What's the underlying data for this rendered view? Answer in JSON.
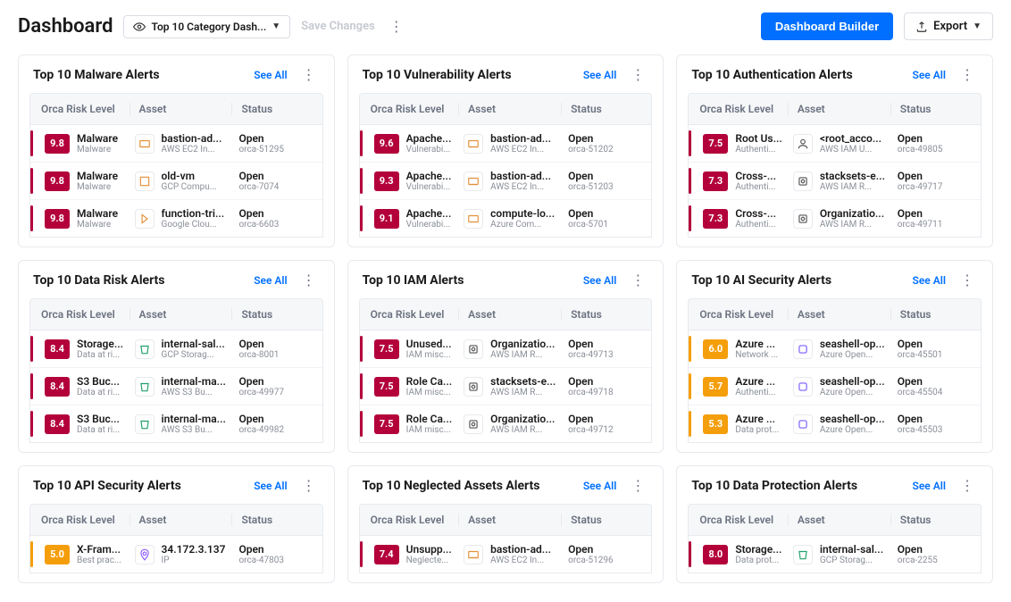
{
  "header": {
    "title": "Dashboard",
    "dashboard_selector": "Top 10 Category Dash...",
    "save_label": "Save Changes",
    "builder_label": "Dashboard Builder",
    "export_label": "Export"
  },
  "labels": {
    "see_all": "See All",
    "columns": {
      "risk": "Orca Risk Level",
      "asset": "Asset",
      "status": "Status"
    }
  },
  "cards": [
    {
      "title": "Top 10 Malware Alerts",
      "rows": [
        {
          "score": "9.8",
          "sev": "crimson",
          "risk_l1": "Malware",
          "risk_l2": "Malware",
          "asset_l1": "bastion-ad...",
          "asset_l2": "AWS EC2 In...",
          "status_l1": "Open",
          "status_l2": "orca-51295",
          "icon": "aws"
        },
        {
          "score": "9.8",
          "sev": "crimson",
          "risk_l1": "Malware",
          "risk_l2": "Malware",
          "asset_l1": "old-vm",
          "asset_l2": "GCP Compu...",
          "status_l1": "Open",
          "status_l2": "orca-7074",
          "icon": "gcp"
        },
        {
          "score": "9.8",
          "sev": "crimson",
          "risk_l1": "Malware",
          "risk_l2": "Malware",
          "asset_l1": "function-tri...",
          "asset_l2": "Google Clou...",
          "status_l1": "Open",
          "status_l2": "orca-6603",
          "icon": "gcp-fn"
        }
      ]
    },
    {
      "title": "Top 10 Vulnerability Alerts",
      "rows": [
        {
          "score": "9.6",
          "sev": "crimson",
          "risk_l1": "Apache...",
          "risk_l2": "Vulnerabi...",
          "asset_l1": "bastion-ad...",
          "asset_l2": "AWS EC2 In...",
          "status_l1": "Open",
          "status_l2": "orca-51202",
          "icon": "aws"
        },
        {
          "score": "9.3",
          "sev": "crimson",
          "risk_l1": "Apache...",
          "risk_l2": "Vulnerabi...",
          "asset_l1": "bastion-ad...",
          "asset_l2": "AWS EC2 In...",
          "status_l1": "Open",
          "status_l2": "orca-51203",
          "icon": "aws"
        },
        {
          "score": "9.1",
          "sev": "crimson",
          "risk_l1": "Apache...",
          "risk_l2": "Vulnerabi...",
          "asset_l1": "compute-lo...",
          "asset_l2": "Azure Com...",
          "status_l1": "Open",
          "status_l2": "orca-5701",
          "icon": "azure"
        }
      ]
    },
    {
      "title": "Top 10 Authentication Alerts",
      "rows": [
        {
          "score": "7.5",
          "sev": "crimson",
          "risk_l1": "Root Us...",
          "risk_l2": "Authenti...",
          "asset_l1": "<root_acco...",
          "asset_l2": "AWS IAM U...",
          "status_l1": "Open",
          "status_l2": "orca-49805",
          "icon": "user"
        },
        {
          "score": "7.3",
          "sev": "crimson",
          "risk_l1": "Cross-...",
          "risk_l2": "Authenti...",
          "asset_l1": "stacksets-e...",
          "asset_l2": "AWS IAM R...",
          "status_l1": "Open",
          "status_l2": "orca-49717",
          "icon": "iam"
        },
        {
          "score": "7.3",
          "sev": "crimson",
          "risk_l1": "Cross-...",
          "risk_l2": "Authenti...",
          "asset_l1": "Organizatio...",
          "asset_l2": "AWS IAM R...",
          "status_l1": "Open",
          "status_l2": "orca-49711",
          "icon": "iam"
        }
      ]
    },
    {
      "title": "Top 10 Data Risk Alerts",
      "rows": [
        {
          "score": "8.4",
          "sev": "crimson",
          "risk_l1": "Storage...",
          "risk_l2": "Data at ri...",
          "asset_l1": "internal-sal...",
          "asset_l2": "GCP Storag...",
          "status_l1": "Open",
          "status_l2": "orca-8001",
          "icon": "bucket"
        },
        {
          "score": "8.4",
          "sev": "crimson",
          "risk_l1": "S3 Buc...",
          "risk_l2": "Data at ri...",
          "asset_l1": "internal-ma...",
          "asset_l2": "AWS S3 Bu...",
          "status_l1": "Open",
          "status_l2": "orca-49977",
          "icon": "bucket"
        },
        {
          "score": "8.4",
          "sev": "crimson",
          "risk_l1": "S3 Buc...",
          "risk_l2": "Data at ri...",
          "asset_l1": "internal-ma...",
          "asset_l2": "AWS S3 Bu...",
          "status_l1": "Open",
          "status_l2": "orca-49982",
          "icon": "bucket"
        }
      ]
    },
    {
      "title": "Top 10 IAM Alerts",
      "rows": [
        {
          "score": "7.5",
          "sev": "crimson",
          "risk_l1": "Unused...",
          "risk_l2": "IAM misc...",
          "asset_l1": "Organizatio...",
          "asset_l2": "AWS IAM R...",
          "status_l1": "Open",
          "status_l2": "orca-49713",
          "icon": "iam"
        },
        {
          "score": "7.5",
          "sev": "crimson",
          "risk_l1": "Role Ca...",
          "risk_l2": "IAM misc...",
          "asset_l1": "stacksets-e...",
          "asset_l2": "AWS IAM R...",
          "status_l1": "Open",
          "status_l2": "orca-49718",
          "icon": "iam"
        },
        {
          "score": "7.5",
          "sev": "crimson",
          "risk_l1": "Role Ca...",
          "risk_l2": "IAM misc...",
          "asset_l1": "Organizatio...",
          "asset_l2": "AWS IAM R...",
          "status_l1": "Open",
          "status_l2": "orca-49712",
          "icon": "iam"
        }
      ]
    },
    {
      "title": "Top 10 AI Security Alerts",
      "rows": [
        {
          "score": "6.0",
          "sev": "orange",
          "risk_l1": "Azure ...",
          "risk_l2": "Network ...",
          "asset_l1": "seashell-op...",
          "asset_l2": "Azure Open...",
          "status_l1": "Open",
          "status_l2": "orca-45501",
          "icon": "ai"
        },
        {
          "score": "5.7",
          "sev": "orange",
          "risk_l1": "Azure ...",
          "risk_l2": "Authenti...",
          "asset_l1": "seashell-op...",
          "asset_l2": "Azure Open...",
          "status_l1": "Open",
          "status_l2": "orca-45504",
          "icon": "ai"
        },
        {
          "score": "5.3",
          "sev": "orange",
          "risk_l1": "Azure ...",
          "risk_l2": "Data prot...",
          "asset_l1": "seashell-op...",
          "asset_l2": "Azure Open...",
          "status_l1": "Open",
          "status_l2": "orca-45503",
          "icon": "ai"
        }
      ]
    },
    {
      "title": "Top 10 API Security Alerts",
      "rows": [
        {
          "score": "5.0",
          "sev": "orange",
          "risk_l1": "X-Fram...",
          "risk_l2": "Best prac...",
          "asset_l1": "34.172.3.137",
          "asset_l2": "IP",
          "status_l1": "Open",
          "status_l2": "orca-47803",
          "icon": "ip"
        }
      ]
    },
    {
      "title": "Top 10 Neglected Assets Alerts",
      "rows": [
        {
          "score": "7.4",
          "sev": "crimson",
          "risk_l1": "Unsupp...",
          "risk_l2": "Neglecte...",
          "asset_l1": "bastion-ad...",
          "asset_l2": "AWS EC2 In...",
          "status_l1": "Open",
          "status_l2": "orca-51296",
          "icon": "aws"
        }
      ]
    },
    {
      "title": "Top 10 Data Protection Alerts",
      "rows": [
        {
          "score": "8.0",
          "sev": "crimson",
          "risk_l1": "Storage...",
          "risk_l2": "Data prot...",
          "asset_l1": "internal-sal...",
          "asset_l2": "GCP Storag...",
          "status_l1": "Open",
          "status_l2": "orca-2255",
          "icon": "bucket"
        }
      ]
    }
  ]
}
